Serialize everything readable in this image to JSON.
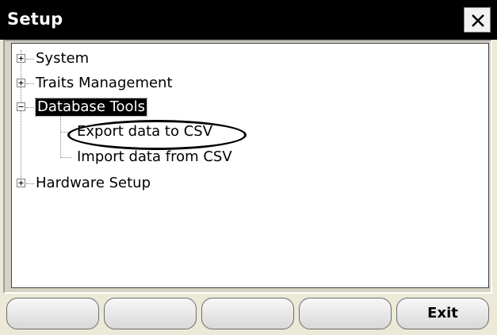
{
  "window": {
    "title": "Setup"
  },
  "tree": {
    "items": [
      {
        "label": "System",
        "expanded": false
      },
      {
        "label": "Traits Management",
        "expanded": false
      },
      {
        "label": "Database Tools",
        "expanded": true,
        "selected": true,
        "children": [
          {
            "label": "Export data to CSV",
            "highlighted": true
          },
          {
            "label": "Import data from CSV"
          }
        ]
      },
      {
        "label": "Hardware Setup",
        "expanded": false
      }
    ]
  },
  "buttons": [
    "",
    "",
    "",
    "",
    "Exit"
  ],
  "icons": {
    "close": "close-icon",
    "expand": "plus-icon",
    "collapse": "minus-icon"
  },
  "colors": {
    "titlebar": "#000000",
    "title_text": "#ffffff",
    "window_bg": "#ece9d8",
    "selection": "#000000"
  }
}
